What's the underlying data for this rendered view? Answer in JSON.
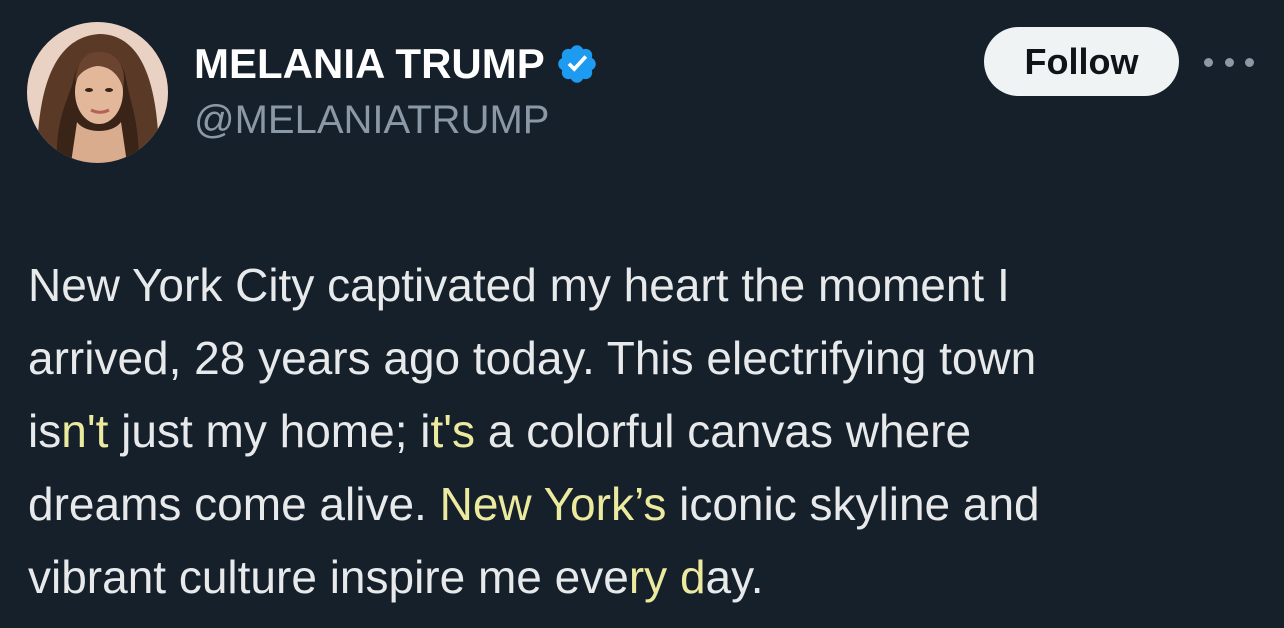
{
  "author": {
    "display_name": "MELANIA TRUMP",
    "handle": "@MELANIATRUMP",
    "verified": true,
    "verified_badge_color": "#1d9bf0"
  },
  "actions": {
    "follow_label": "Follow",
    "more_icon": "more-horizontal-icon"
  },
  "tweet": {
    "lines": [
      {
        "parts": [
          {
            "text": "New York City captivated my heart the moment I"
          }
        ]
      },
      {
        "parts": [
          {
            "text": "arrived, 28 years ago today. This electrifying town"
          }
        ]
      },
      {
        "parts": [
          {
            "text": "is"
          },
          {
            "text": "n't",
            "highlight": true
          },
          {
            "text": " just my home; i"
          },
          {
            "text": "t's",
            "highlight": true
          },
          {
            "text": " a colorful canvas where"
          }
        ]
      },
      {
        "parts": [
          {
            "text": "dreams come alive. "
          },
          {
            "text": "New York’s",
            "highlight": true
          },
          {
            "text": " iconic skyline and"
          }
        ]
      },
      {
        "parts": [
          {
            "text": "vibrant culture inspire me eve"
          },
          {
            "text": "ry d",
            "highlight": true
          },
          {
            "text": "ay."
          }
        ]
      }
    ]
  },
  "colors": {
    "background": "#15202b",
    "text": "#e7e9ea",
    "secondary_text": "#8b98a5",
    "highlight_text": "#ecea9e",
    "follow_button_bg": "#eff3f4"
  }
}
